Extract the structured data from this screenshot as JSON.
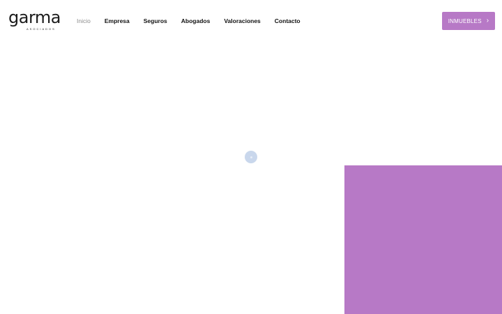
{
  "brand": {
    "logo_text": "garma",
    "logo_subtext": "ASOCIADOS"
  },
  "nav": {
    "items": [
      {
        "label": "Inicio",
        "active": true
      },
      {
        "label": "Empresa",
        "active": false
      },
      {
        "label": "Seguros",
        "active": false
      },
      {
        "label": "Abogados",
        "active": false
      },
      {
        "label": "Valoraciones",
        "active": false
      },
      {
        "label": "Contacto",
        "active": false
      }
    ]
  },
  "cta": {
    "label": "INMUEBLES",
    "icon": "chevron-right-icon"
  },
  "loader": {
    "icon": "loading-spinner-icon"
  },
  "colors": {
    "accent": "#b779c6",
    "text": "#111111",
    "nav_active": "#8c8c8c",
    "loader": "#c9d7ec",
    "background": "#ffffff"
  }
}
